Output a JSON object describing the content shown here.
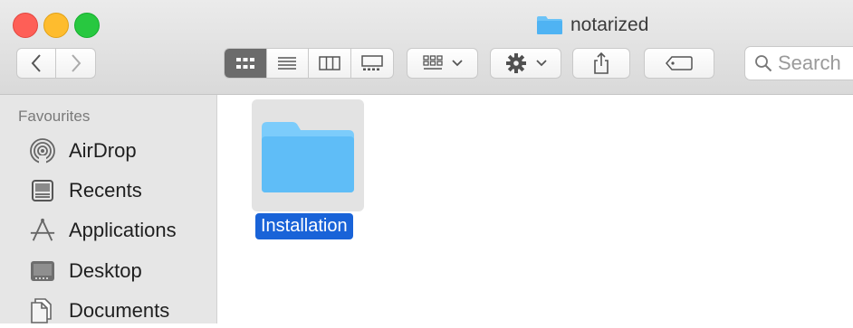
{
  "window": {
    "title": "notarized"
  },
  "toolbar": {
    "view_modes": [
      {
        "name": "icon-view",
        "active": true
      },
      {
        "name": "list-view",
        "active": false
      },
      {
        "name": "column-view",
        "active": false
      },
      {
        "name": "gallery-view",
        "active": false
      }
    ],
    "search_placeholder": "Search"
  },
  "sidebar": {
    "section": "Favourites",
    "items": [
      {
        "label": "AirDrop",
        "icon": "airdrop-icon"
      },
      {
        "label": "Recents",
        "icon": "recents-icon"
      },
      {
        "label": "Applications",
        "icon": "applications-icon"
      },
      {
        "label": "Desktop",
        "icon": "desktop-icon"
      },
      {
        "label": "Documents",
        "icon": "documents-icon"
      }
    ]
  },
  "content": {
    "items": [
      {
        "name": "Installation",
        "type": "folder",
        "selected": true
      }
    ]
  },
  "colors": {
    "selection": "#1963d8",
    "folder": "#5fbdf7"
  }
}
